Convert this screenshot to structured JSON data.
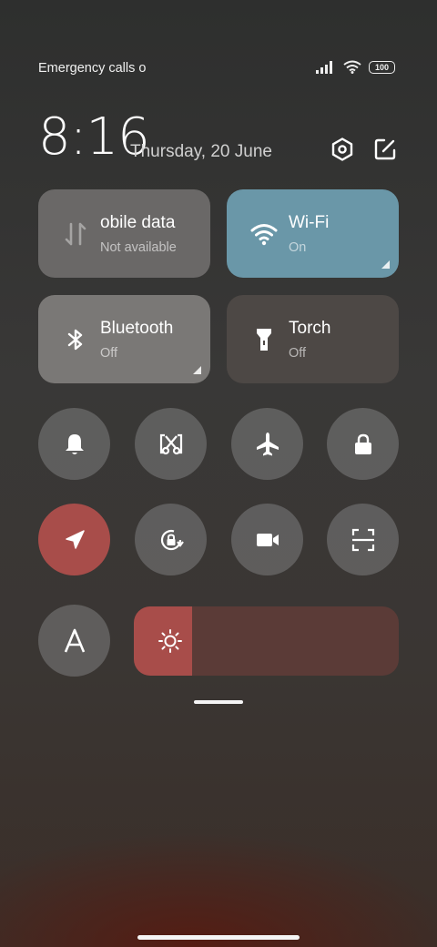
{
  "status_bar": {
    "text": "Emergency calls o",
    "battery": "100"
  },
  "header": {
    "time": "8:16",
    "date": "Thursday, 20 June",
    "settings_icon": "settings-hexagon-icon",
    "edit_icon": "edit-icon"
  },
  "tiles": {
    "mobile_data": {
      "label": "obile data",
      "sub": "Not available",
      "icon": "mobile-data-arrows-icon",
      "color": "#6a6867"
    },
    "wifi": {
      "label": "Wi-Fi",
      "sub": "On",
      "icon": "wifi-icon",
      "color": "#6a97a8"
    },
    "bluetooth": {
      "label": "Bluetooth",
      "sub": "Off",
      "icon": "bluetooth-icon",
      "color": "#7a7876"
    },
    "torch": {
      "label": "Torch",
      "sub": "Off",
      "icon": "torch-icon",
      "color": "#4d4845"
    }
  },
  "toggles": [
    {
      "name": "silent-toggle",
      "icon": "bell-icon",
      "active": false
    },
    {
      "name": "screenshot-toggle",
      "icon": "scissors-screenshot-icon",
      "active": false
    },
    {
      "name": "airplane-toggle",
      "icon": "airplane-icon",
      "active": false
    },
    {
      "name": "lock-screen-toggle",
      "icon": "lock-icon",
      "active": false
    },
    {
      "name": "location-toggle",
      "icon": "location-arrow-icon",
      "active": true
    },
    {
      "name": "rotation-lock-toggle",
      "icon": "rotation-lock-icon",
      "active": false
    },
    {
      "name": "screen-recorder-toggle",
      "icon": "video-camera-icon",
      "active": false
    },
    {
      "name": "scanner-toggle",
      "icon": "scan-frame-icon",
      "active": false
    },
    {
      "name": "reading-mode-toggle",
      "icon": "letter-a-icon",
      "active": false
    }
  ],
  "brightness": {
    "level": 0.22,
    "icon": "sun-icon"
  },
  "colors": {
    "active_red": "#a84d4a",
    "wifi_blue": "#6a97a8"
  }
}
